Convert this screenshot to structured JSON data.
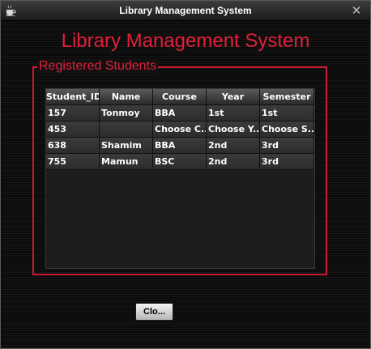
{
  "window": {
    "title": "Library Management System",
    "close_glyph": "✕"
  },
  "heading": "Library Management System",
  "group": {
    "legend": "Registered Students"
  },
  "table": {
    "columns": [
      "Student_ID",
      "Name",
      "Course",
      "Year",
      "Semester"
    ],
    "rows": [
      [
        "157",
        "Tonmoy",
        "BBA",
        "1st",
        "1st"
      ],
      [
        "453",
        "",
        "Choose C...",
        "Choose Y...",
        "Choose S..."
      ],
      [
        "638",
        "Shamim",
        "BBA",
        "2nd",
        "3rd"
      ],
      [
        "755",
        "Mamun",
        "BSC",
        "2nd",
        "3rd"
      ]
    ]
  },
  "buttons": {
    "close_label": "Clo..."
  },
  "colors": {
    "accent": "#e21f3a",
    "border_accent": "#cc1a35",
    "background": "#000000"
  },
  "icons": {
    "app": "coffee-cup-icon",
    "close": "close-icon"
  }
}
